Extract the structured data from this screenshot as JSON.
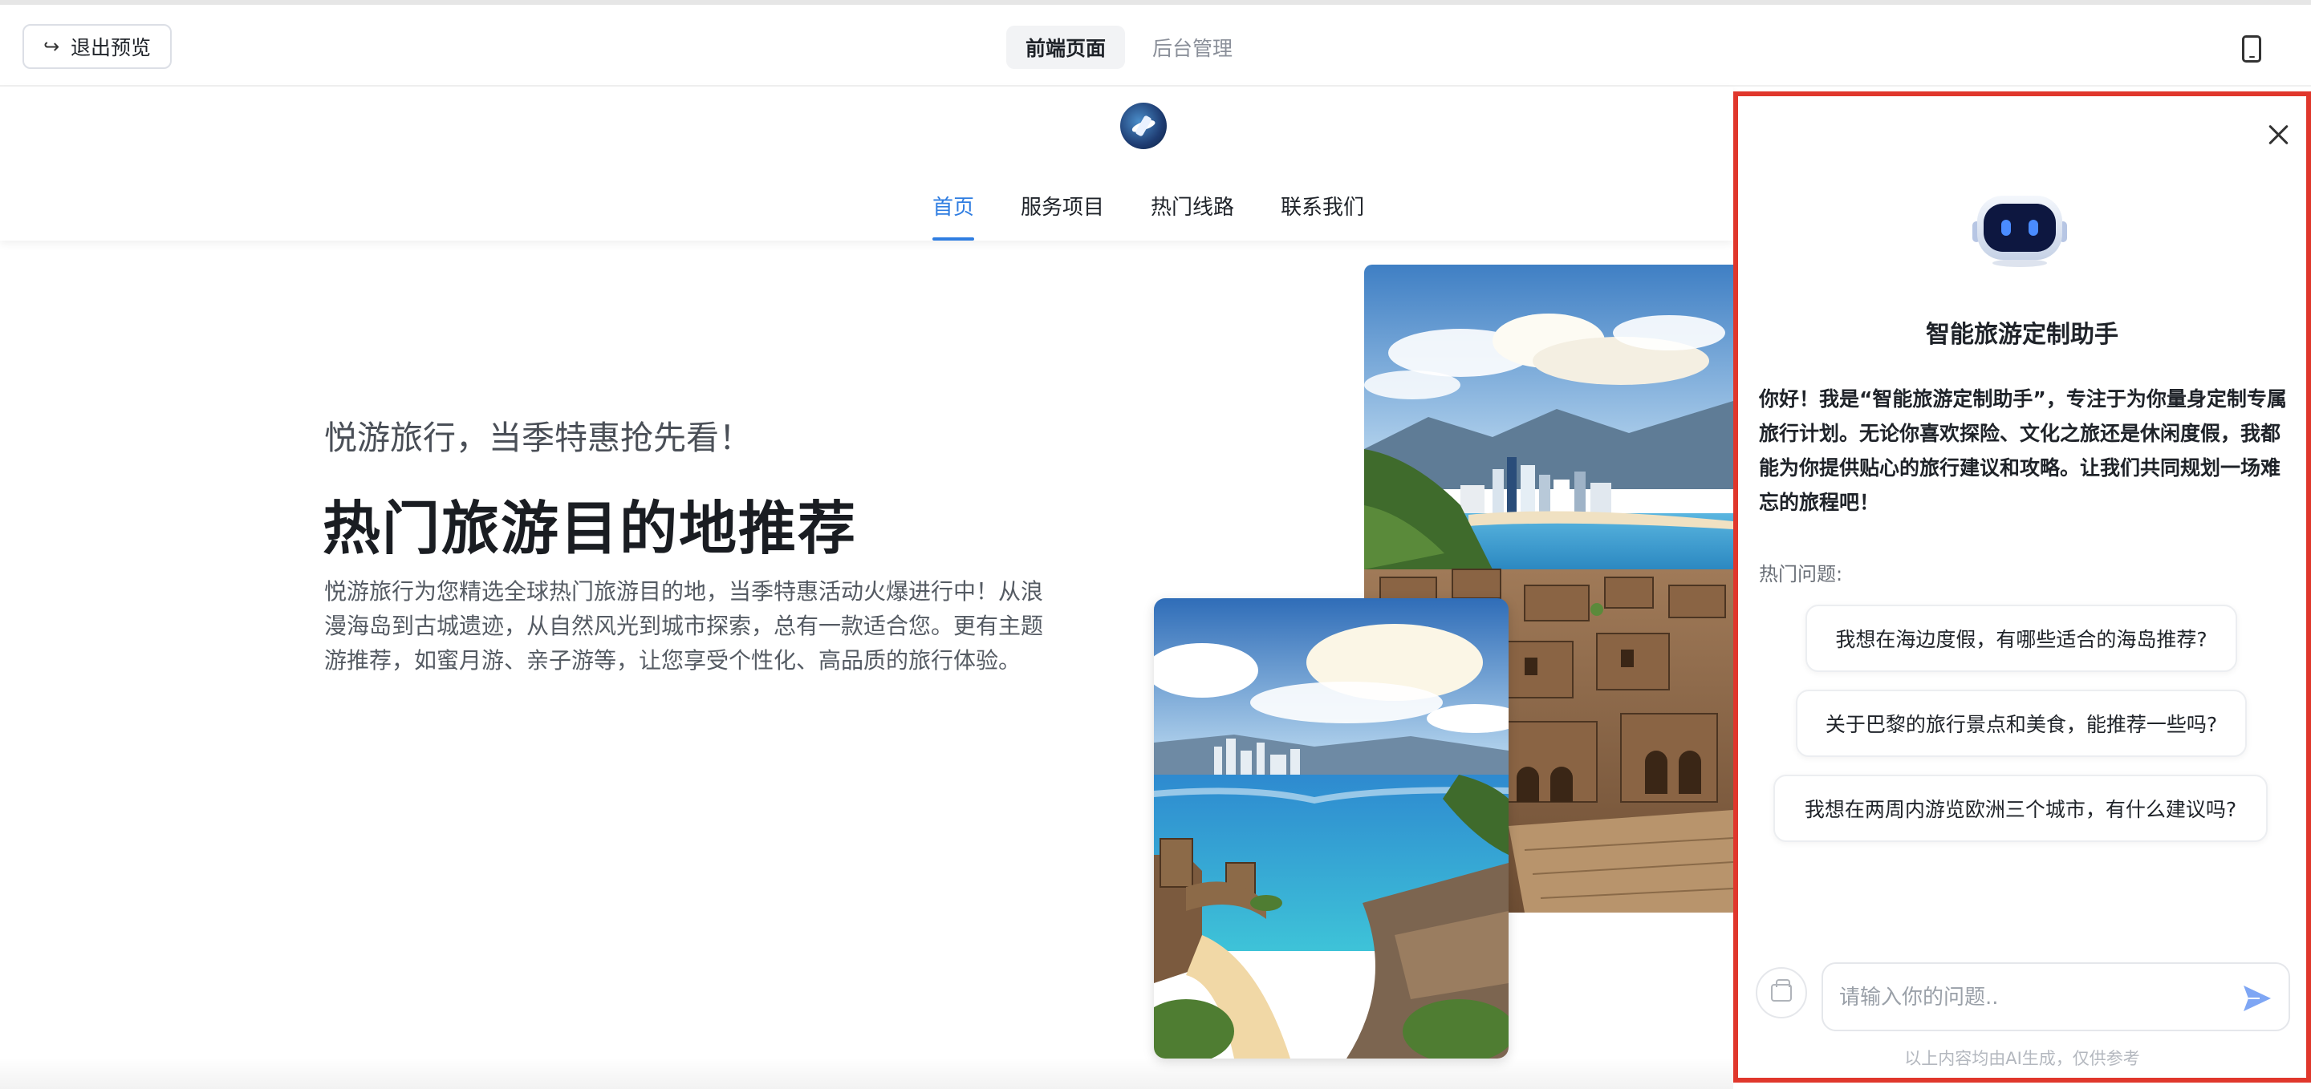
{
  "toolbar": {
    "exit_label": "退出预览",
    "tabs": [
      {
        "label": "前端页面",
        "active": true
      },
      {
        "label": "后台管理",
        "active": false
      }
    ],
    "device_icon": "mobile-phone-icon"
  },
  "site": {
    "nav": [
      {
        "label": "首页",
        "active": true
      },
      {
        "label": "服务项目",
        "active": false
      },
      {
        "label": "热门线路",
        "active": false
      },
      {
        "label": "联系我们",
        "active": false
      }
    ],
    "accent_color": "#2f7de1"
  },
  "hero": {
    "subtitle": "悦游旅行，当季特惠抢先看！",
    "title": "热门旅游目的地推荐",
    "description": "悦游旅行为您精选全球热门旅游目的地，当季特惠活动火爆进行中！从浪漫海岛到古城遗迹，从自然风光到城市探索，总有一款适合您。更有主题游推荐，如蜜月游、亲子游等，让您享受个性化、高品质的旅行体验。"
  },
  "chat": {
    "title": "智能旅游定制助手",
    "intro": "你好！我是“智能旅游定制助手”，专注于为你量身定制专属旅行计划。无论你喜欢探险、文化之旅还是休闲度假，我都能为你提供贴心的旅行建议和攻略。让我们共同规划一场难忘的旅程吧！",
    "hot_label": "热门问题:",
    "questions": [
      "我想在海边度假，有哪些适合的海岛推荐?",
      "关于巴黎的旅行景点和美食，能推荐一些吗?",
      "我想在两周内游览欧洲三个城市，有什么建议吗?"
    ],
    "input_placeholder": "请输入你的问题..",
    "disclaimer": "以上内容均由AI生成，仅供参考",
    "highlight_color": "#e0372c"
  }
}
